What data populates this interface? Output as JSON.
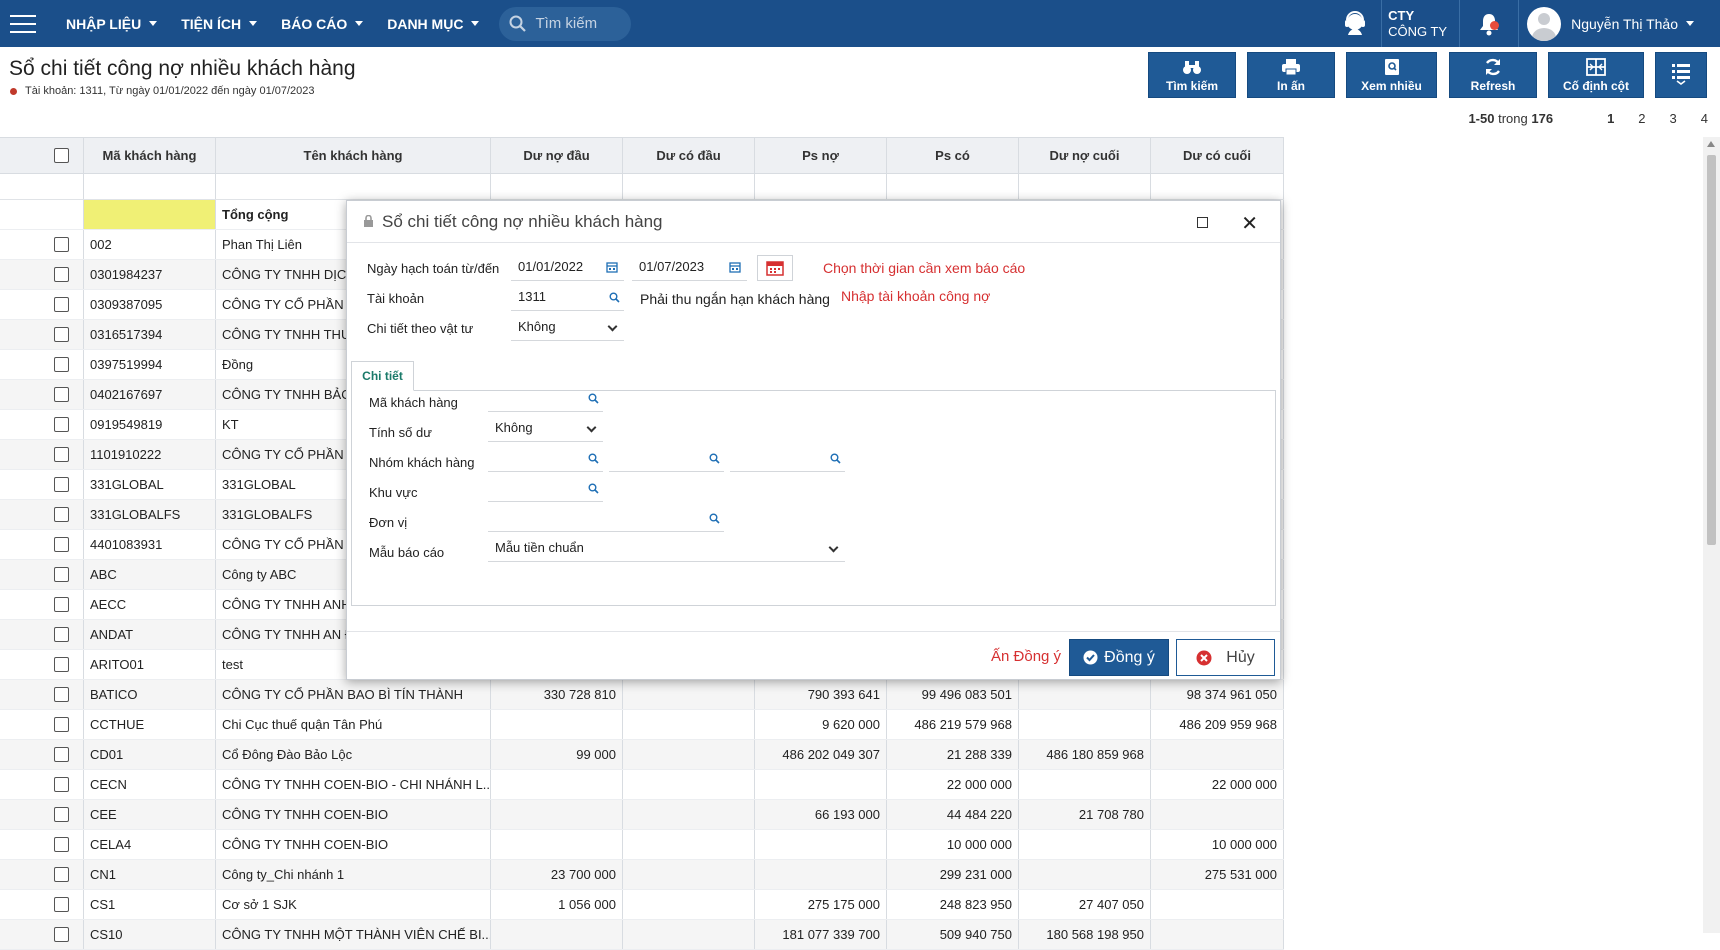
{
  "nav": {
    "menus": [
      "NHẬP LIỆU",
      "TIỆN ÍCH",
      "BÁO CÁO",
      "DANH MỤC"
    ],
    "search_placeholder": "Tìm kiếm",
    "company_line1": "CTY",
    "company_line2": "CÔNG TY",
    "user_name": "Nguyễn Thị Thảo",
    "bar_color": "#1b4f8a"
  },
  "page": {
    "title": "Sổ chi tiết công nợ nhiều khách hàng",
    "subtitle": "Tài khoản: 1311, Từ ngày 01/01/2022 đến ngày 01/07/2023"
  },
  "toolbar": {
    "search": "Tìm kiếm",
    "print": "In ấn",
    "view_many": "Xem nhiều",
    "refresh": "Refresh",
    "pin_cols": "Cố định cột",
    "icons": [
      "binoculars-icon",
      "printer-icon",
      "document-search-icon",
      "refresh-icon",
      "columns-pin-icon",
      "list-menu-icon"
    ]
  },
  "pager": {
    "range": "1-50",
    "in": "trong",
    "total": "176",
    "pages": [
      "1",
      "2",
      "3",
      "4"
    ],
    "current": "1"
  },
  "grid": {
    "headers": [
      "Mã khách hàng",
      "Tên khách hàng",
      "Dư nợ đầu",
      "Dư có đầu",
      "Ps nợ",
      "Ps có",
      "Dư nợ cuối",
      "Dư có cuối"
    ],
    "total_label": "Tổng cộng",
    "rows": [
      [
        "002",
        "Phan Thị Liên",
        "",
        "",
        "",
        "",
        "",
        ""
      ],
      [
        "0301984237",
        "CÔNG TY TNHH DỊCH",
        "",
        "",
        "",
        "",
        "",
        ""
      ],
      [
        "0309387095",
        "CÔNG TY CỔ PHẦN D",
        "",
        "",
        "",
        "",
        "",
        ""
      ],
      [
        "0316517394",
        "CÔNG TY TNHH THƯ",
        "",
        "",
        "",
        "",
        "",
        ""
      ],
      [
        "0397519994",
        "Đồng",
        "",
        "",
        "",
        "",
        "",
        ""
      ],
      [
        "0402167697",
        "CÔNG TY TNHH BẢO",
        "",
        "",
        "",
        "",
        "",
        ""
      ],
      [
        "0919549819",
        "KT",
        "",
        "",
        "",
        "",
        "",
        ""
      ],
      [
        "1101910222",
        "CÔNG TY CỔ PHẦN B",
        "",
        "",
        "",
        "",
        "",
        ""
      ],
      [
        "331GLOBAL",
        "331GLOBAL",
        "",
        "",
        "",
        "",
        "",
        ""
      ],
      [
        "331GLOBALFS",
        "331GLOBALFS",
        "",
        "",
        "",
        "",
        "",
        ""
      ],
      [
        "4401083931",
        "CÔNG TY CỔ PHẦN S",
        "",
        "",
        "",
        "",
        "",
        ""
      ],
      [
        "ABC",
        "Công ty ABC",
        "",
        "",
        "",
        "",
        "",
        ""
      ],
      [
        "AECC",
        "CÔNG TY TNHH ANH",
        "",
        "",
        "",
        "",
        "",
        ""
      ],
      [
        "ANDAT",
        "CÔNG TY TNHH AN Đ",
        "",
        "",
        "",
        "",
        "",
        ""
      ],
      [
        "ARITO01",
        "test",
        "",
        "",
        "",
        "",
        "",
        ""
      ],
      [
        "BATICO",
        "CÔNG TY CỔ PHẦN BAO BÌ TÍN THÀNH",
        "330 728 810",
        "",
        "790 393 641",
        "99 496 083 501",
        "",
        "98 374 961 050"
      ],
      [
        "CCTHUE",
        "Chi Cục thuế quận Tân Phú",
        "",
        "",
        "9 620 000",
        "486 219 579 968",
        "",
        "486 209 959 968"
      ],
      [
        "CD01",
        "Cổ Đông Đào Bảo Lộc",
        "99 000",
        "",
        "486 202 049 307",
        "21 288 339",
        "486 180 859 968",
        ""
      ],
      [
        "CECN",
        "CÔNG TY TNHH COEN-BIO - CHI NHÁNH L...",
        "",
        "",
        "",
        "22 000 000",
        "",
        "22 000 000"
      ],
      [
        "CEE",
        "CÔNG TY TNHH COEN-BIO",
        "",
        "",
        "66 193 000",
        "44 484 220",
        "21 708 780",
        ""
      ],
      [
        "CELA4",
        "CÔNG TY TNHH COEN-BIO",
        "",
        "",
        "",
        "10 000 000",
        "",
        "10 000 000"
      ],
      [
        "CN1",
        "Công ty_Chi nhánh 1",
        "23 700 000",
        "",
        "",
        "299 231 000",
        "",
        "275 531 000"
      ],
      [
        "CS1",
        "Cơ sở 1 SJK",
        "1 056 000",
        "",
        "275 175 000",
        "248 823 950",
        "27 407 050",
        ""
      ],
      [
        "CS10",
        "CÔNG TY TNHH MỘT THÀNH VIÊN CHẾ BI...",
        "",
        "",
        "181 077 339 700",
        "509 940 750",
        "180 568 198 950",
        ""
      ]
    ]
  },
  "dialog": {
    "title": "Sổ chi tiết công nợ nhiều khách hàng",
    "date_label": "Ngày hạch toán từ/đến",
    "date_from": "01/01/2022",
    "date_to": "01/07/2023",
    "date_hint": "Chọn thời gian cần xem báo cáo",
    "account_label": "Tài khoản",
    "account_value": "1311",
    "account_name": "Phải thu ngắn hạn khách hàng",
    "account_hint": "Nhập tài khoản công nợ",
    "detail_label": "Chi tiết theo vật tư",
    "detail_value": "Không",
    "tab_label": "Chi tiết",
    "customer_code_label": "Mã khách hàng",
    "balance_label": "Tính số dư",
    "balance_value": "Không",
    "customer_group_label": "Nhóm khách hàng",
    "area_label": "Khu vực",
    "unit_label": "Đơn vị",
    "template_label": "Mẫu báo cáo",
    "template_value": "Mẫu tiền chuẩn",
    "ok_hint": "Ấn Đồng ý",
    "ok": "Đồng ý",
    "cancel": "Hủy"
  }
}
